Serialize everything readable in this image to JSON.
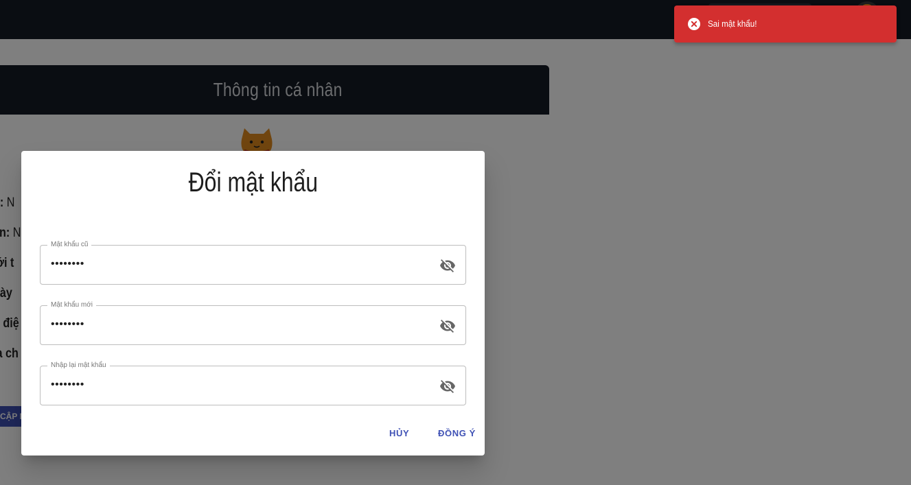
{
  "page": {
    "card_title": "Thông tin cá nhân",
    "info_rows": [
      {
        "label": "ọ:",
        "value": " N"
      },
      {
        "label": "ên:",
        "value": " N"
      },
      {
        "label": "iới t",
        "value": ""
      },
      {
        "label": "gày",
        "value": ""
      },
      {
        "label": "ố điệ",
        "value": ""
      },
      {
        "label": "ịa ch",
        "value": ""
      }
    ],
    "update_button": "CẬP N"
  },
  "dialog": {
    "title": "Đổi mật khẩu",
    "fields": [
      {
        "label": "Mật khẩu cũ",
        "value": "••••••••",
        "icon": "visibility-off-icon"
      },
      {
        "label": "Mật khẩu mới",
        "value": "••••••••",
        "icon": "visibility-off-icon"
      },
      {
        "label": "Nhập lại mật khẩu",
        "value": "••••••••",
        "icon": "visibility-off-icon"
      }
    ],
    "cancel_label": "HỦY",
    "confirm_label": "ĐỒNG Ý"
  },
  "toast": {
    "message": "Sai mật khẩu!",
    "icon": "error-circle-icon",
    "color": "#d32f2f"
  },
  "colors": {
    "header_bg": "#151a24",
    "accent": "#3f51b5"
  }
}
